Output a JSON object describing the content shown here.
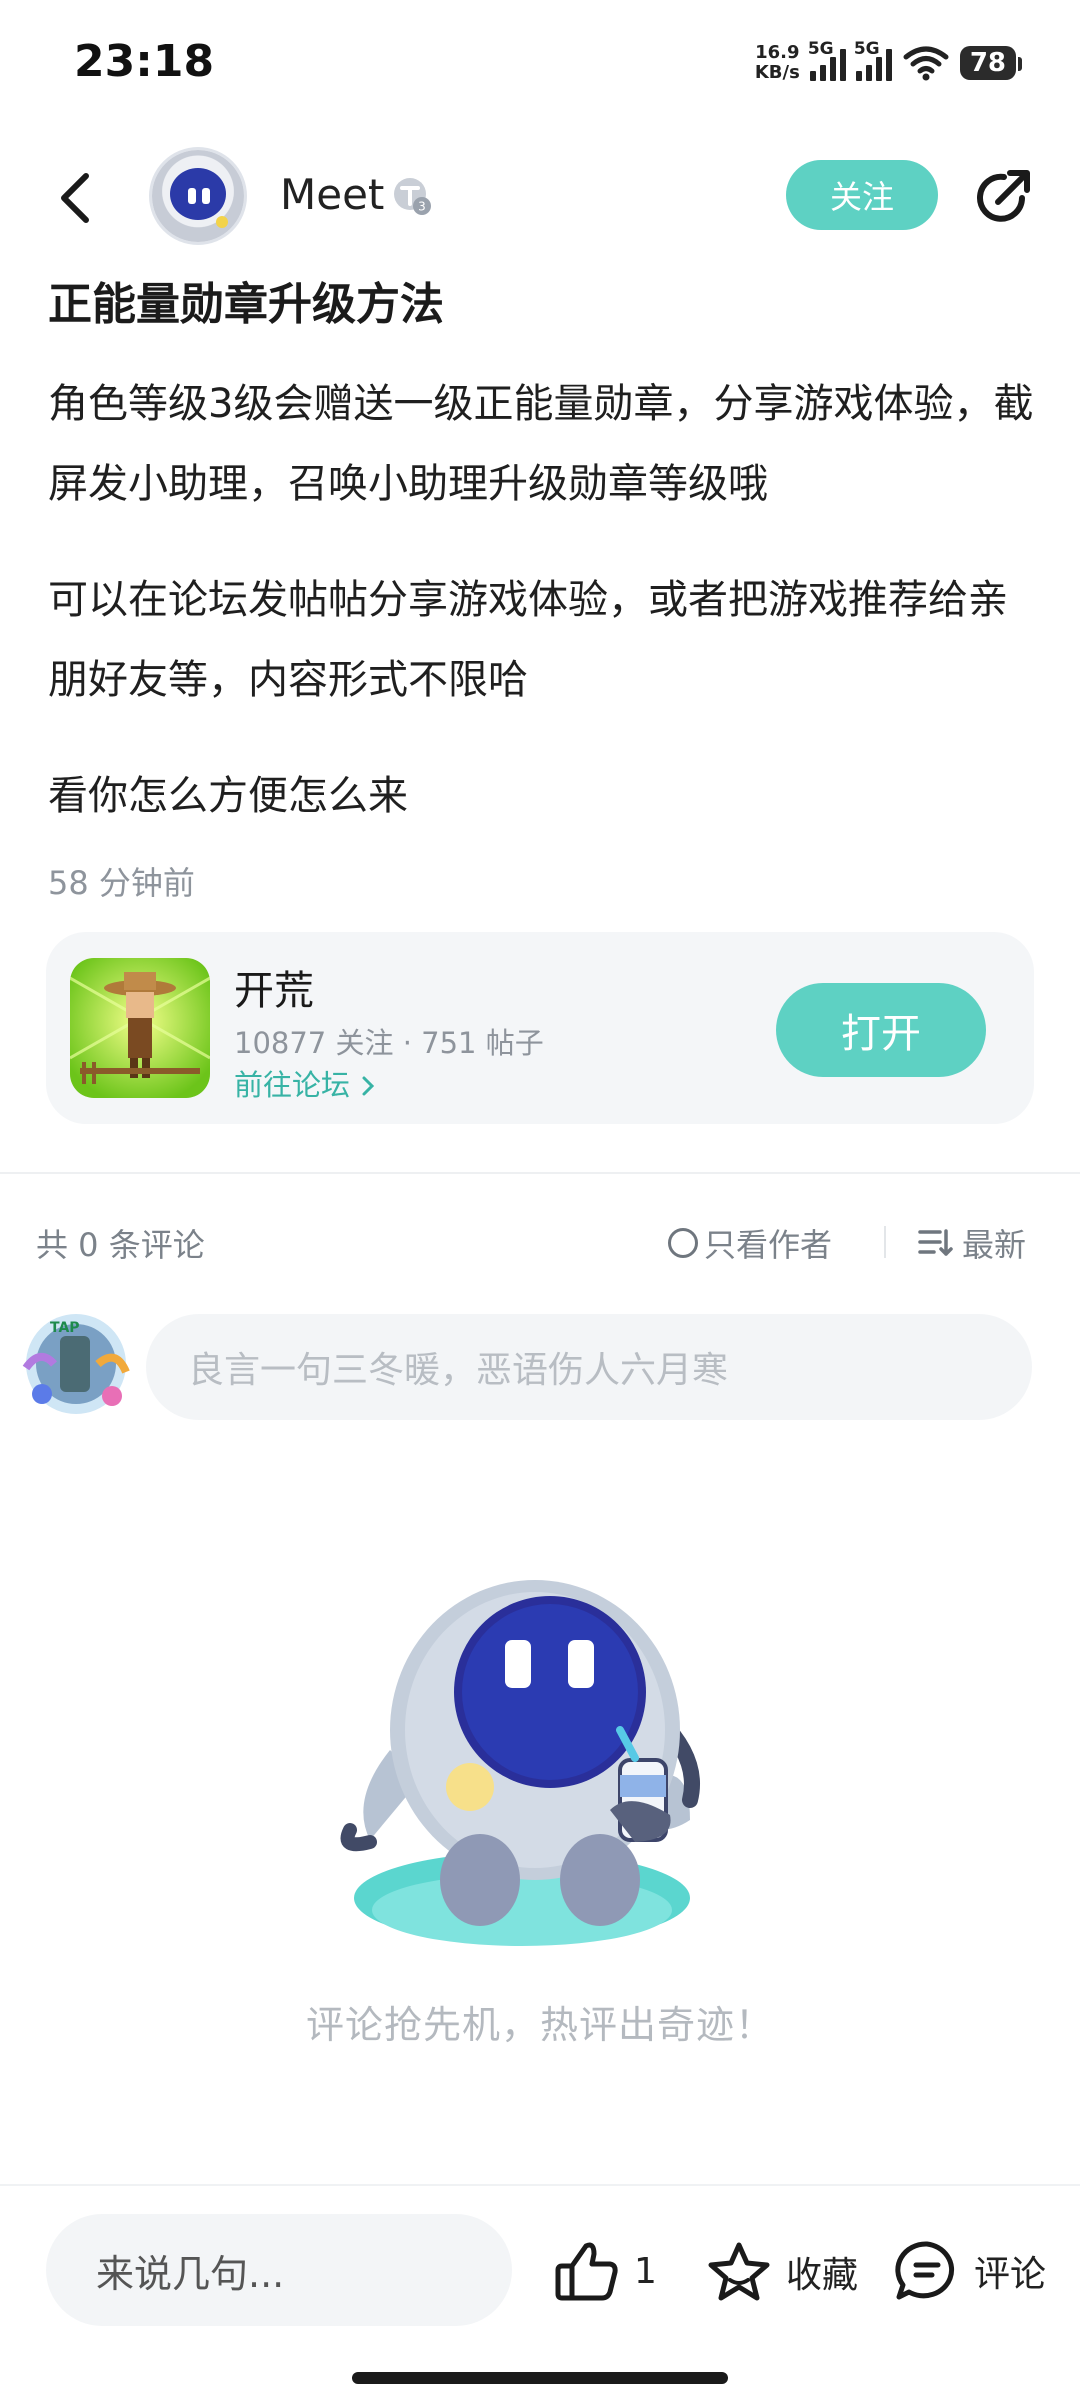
{
  "status": {
    "time": "23:18",
    "net_speed": "16.9",
    "net_unit": "KB/s",
    "sim1": "5G",
    "sim2": "5G",
    "battery": "78"
  },
  "header": {
    "author": "Meet",
    "follow_label": "关注"
  },
  "post": {
    "title": "正能量勋章升级方法",
    "paragraphs": [
      "角色等级3级会赠送一级正能量勋章，分享游戏体验，截屏发小助理，召唤小助理升级勋章等级哦",
      "可以在论坛发帖帖分享游戏体验，或者把游戏推荐给亲朋好友等，内容形式不限哈",
      "看你怎么方便怎么来"
    ],
    "time": "58 分钟前"
  },
  "forum": {
    "name": "开荒",
    "stats": "10877 关注 · 751 帖子",
    "link": "前往论坛",
    "open_label": "打开"
  },
  "comments": {
    "count_label": "共 0 条评论",
    "author_only": "只看作者",
    "sort": "最新",
    "input_placeholder": "良言一句三冬暖，恶语伤人六月寒",
    "empty_text": "评论抢先机，热评出奇迹！"
  },
  "bottom": {
    "input": "来说几句...",
    "like_count": "1",
    "favorite": "收藏",
    "comment": "评论"
  },
  "colors": {
    "accent": "#5ed1c3",
    "link": "#37b3a5",
    "muted": "#8e949c"
  }
}
